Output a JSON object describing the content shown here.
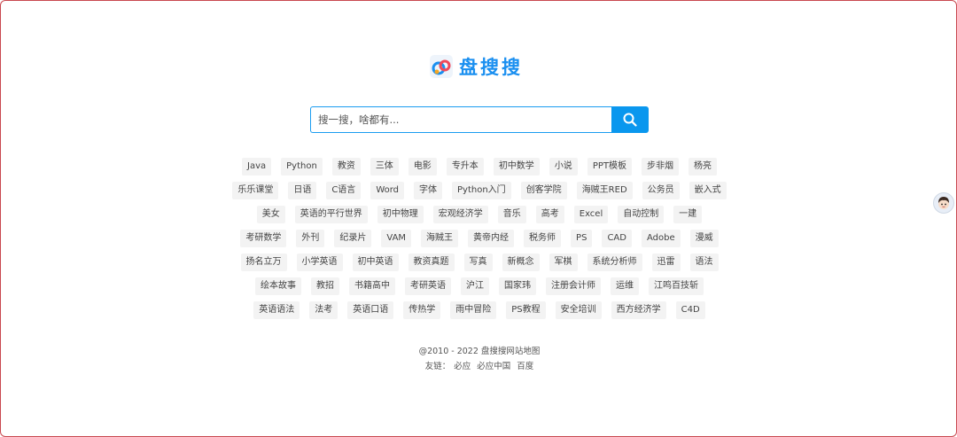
{
  "brand": {
    "name": "盘搜搜",
    "color": "#1a8ff0"
  },
  "search": {
    "placeholder": "搜一搜，啥都有...",
    "value": "",
    "button_icon": "search-icon"
  },
  "tags": [
    [
      "Java",
      "Python",
      "教资",
      "三体",
      "电影",
      "专升本",
      "初中数学",
      "小说",
      "PPT模板",
      "步非烟",
      "杨亮"
    ],
    [
      "乐乐课堂",
      "日语",
      "C语言",
      "Word",
      "字体",
      "Python入门",
      "创客学院",
      "海贼王RED",
      "公务员",
      "嵌入式"
    ],
    [
      "美女",
      "英语的平行世界",
      "初中物理",
      "宏观经济学",
      "音乐",
      "高考",
      "Excel",
      "自动控制",
      "一建"
    ],
    [
      "考研数学",
      "外刊",
      "纪录片",
      "VAM",
      "海贼王",
      "黄帝内经",
      "税务师",
      "PS",
      "CAD",
      "Adobe",
      "漫威"
    ],
    [
      "扬名立万",
      "小学英语",
      "初中英语",
      "教资真题",
      "写真",
      "新概念",
      "军棋",
      "系统分析师",
      "迅雷",
      "语法"
    ],
    [
      "绘本故事",
      "教招",
      "书籍高中",
      "考研英语",
      "沪江",
      "国家玮",
      "注册会计师",
      "运维",
      "江鸣百技斩"
    ],
    [
      "英语语法",
      "法考",
      "英语口语",
      "传热学",
      "雨中冒险",
      "PS教程",
      "安全培训",
      "西方经济学",
      "C4D"
    ]
  ],
  "footer": {
    "copyright": "@2010 - 2022 盘搜搜网站地图",
    "links_label": "友链：",
    "links": [
      "必应",
      "必应中国",
      "百度"
    ]
  },
  "floating": {
    "avatar_icon": "avatar-icon"
  }
}
